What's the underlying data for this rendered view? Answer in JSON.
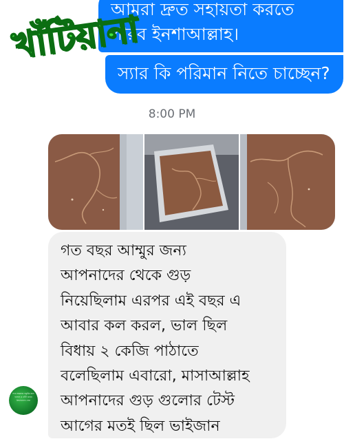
{
  "conversation": {
    "outgoing_message_1": {
      "lines": [
        "আমরা দ্রুত সহায়তা করতে",
        "পারব ইনশাআল্লাহ।"
      ]
    },
    "outgoing_message_2": {
      "text": "স্যার  কি পরিমান নিতে চাচ্ছেন?"
    },
    "watermark_stamp": "খাঁটিয়ানা",
    "timestamp": "8:00 PM",
    "photos": [
      {
        "label": "gur-tray-photo-1"
      },
      {
        "label": "gur-tray-photo-2"
      },
      {
        "label": "gur-tray-photo-3"
      }
    ],
    "incoming_message": {
      "lines": [
        "গত বছর আম্মুর জন্য",
        "আপনাদের থেকে গুড়",
        "নিয়েছিলাম এরপর এই বছর এ",
        "আবার কল করল, ভাল ছিল",
        "বিধায় ২ কেজি পাঠাতে",
        "বলেছিলাম এবারো, মাসাআল্লাহ",
        "আপনাদের গুড় গুলোর টেস্ট",
        "আগের মতই ছিল ভাইজান"
      ]
    },
    "sender_avatar": {
      "lines": [
        "স্যার আল্লাহর সন্তুষ্টির জন্য",
        "হালাল ও খাঁটি খাবার",
        "বিশ্বাসযোগ্য সেবা"
      ]
    }
  },
  "colors": {
    "outgoing_bubble": "#0a7cff",
    "incoming_bubble": "#f0f0f0",
    "stamp_green": "#3fe23f",
    "timestamp_gray": "#6b6f75"
  }
}
